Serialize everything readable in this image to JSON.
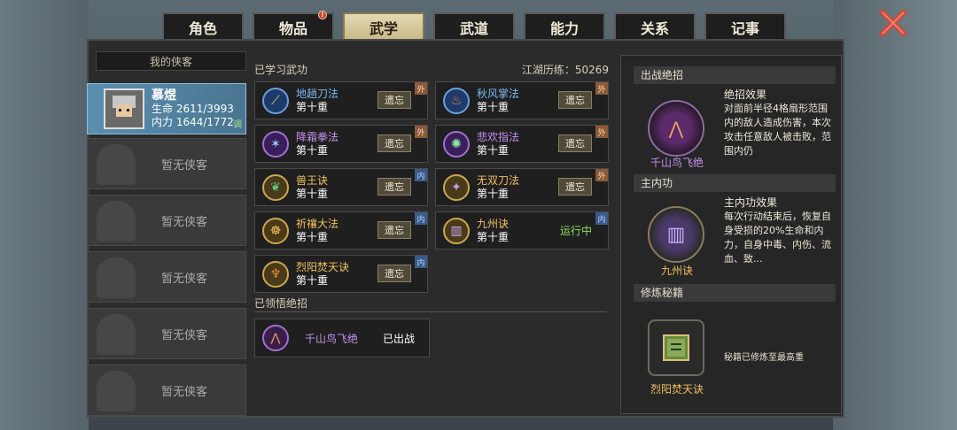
{
  "tabs": [
    {
      "label": "角色"
    },
    {
      "label": "物品",
      "badge": "!"
    },
    {
      "label": "武学",
      "active": true
    },
    {
      "label": "武道"
    },
    {
      "label": "能力"
    },
    {
      "label": "关系"
    },
    {
      "label": "记事"
    }
  ],
  "heroes": {
    "title": "我的侠客",
    "active": {
      "name": "慕煜",
      "hp": "生命 2611/3993",
      "mp": "内力 1644/1772",
      "tag": "调"
    },
    "empty_label": "暂无侠客"
  },
  "learned": {
    "label": "已学习武功",
    "jianghu": "江湖历练：50269",
    "forget_label": "遗忘",
    "running_label": "运行中",
    "skills": [
      {
        "name": "地趟刀法",
        "level": "第十重",
        "type": "外",
        "color": "blue",
        "icon": "blade-icon"
      },
      {
        "name": "秋风掌法",
        "level": "第十重",
        "type": "外",
        "color": "blue",
        "icon": "palm-icon"
      },
      {
        "name": "降霜拳法",
        "level": "第十重",
        "type": "外",
        "color": "purple",
        "icon": "fist-icon"
      },
      {
        "name": "悲欢指法",
        "level": "第十重",
        "type": "外",
        "color": "purple",
        "icon": "finger-icon"
      },
      {
        "name": "兽王诀",
        "level": "第十重",
        "type": "内",
        "color": "gold",
        "icon": "beast-icon"
      },
      {
        "name": "无双刀法",
        "level": "第十重",
        "type": "外",
        "color": "gold",
        "icon": "sword-icon"
      },
      {
        "name": "祈禳大法",
        "level": "第十重",
        "type": "内",
        "color": "gold",
        "icon": "pray-icon"
      },
      {
        "name": "九州诀",
        "level": "第十重",
        "type": "内",
        "color": "gold",
        "icon": "pillar-icon",
        "running": true
      },
      {
        "name": "烈阳焚天诀",
        "level": "第十重",
        "type": "内",
        "color": "gold",
        "icon": "sun-icon"
      }
    ]
  },
  "ultimate": {
    "label": "已领悟绝招",
    "name": "千山鸟飞绝",
    "status": "已出战"
  },
  "right": {
    "battle": {
      "header": "出战绝招",
      "name": "千山鸟飞绝",
      "title": "绝招效果",
      "desc": "对面前半径4格扇形范围内的敌人造成伤害，本次攻击任意敌人被击败，范围内仍"
    },
    "inner": {
      "header": "主内功",
      "name": "九州诀",
      "title": "主内功效果",
      "desc": "每次行动结束后，恢复自身受损的20%生命和内力，自身中毒、内伤、流血、致..."
    },
    "secret": {
      "header": "修炼秘籍",
      "name": "烈阳焚天诀",
      "note": "秘籍已修炼至最高重"
    }
  }
}
